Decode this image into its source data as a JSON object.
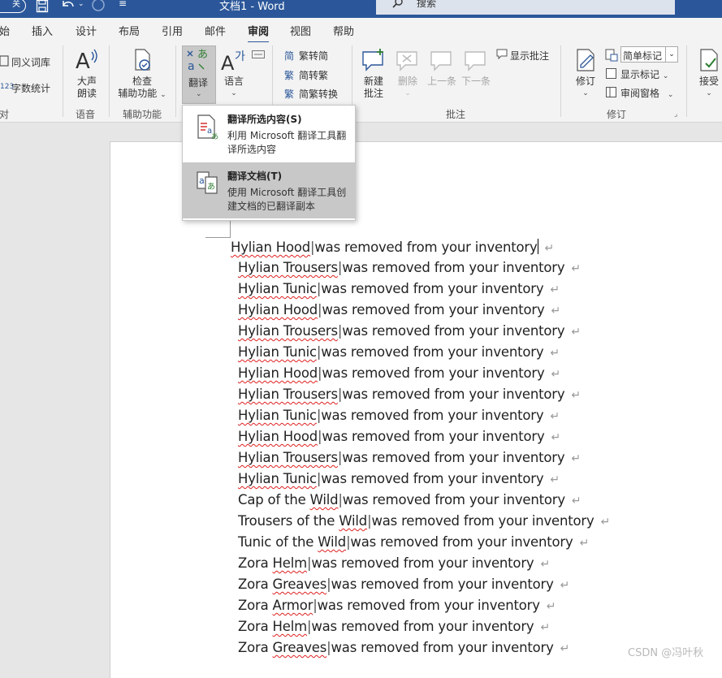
{
  "titlebar": {
    "toggle_label": "关",
    "doc_title": "文档1  -  Word",
    "search_placeholder": "搜索"
  },
  "tabs": [
    {
      "label": "开始",
      "shown": "始"
    },
    {
      "label": "插入"
    },
    {
      "label": "设计"
    },
    {
      "label": "布局"
    },
    {
      "label": "引用"
    },
    {
      "label": "邮件"
    },
    {
      "label": "审阅",
      "active": true
    },
    {
      "label": "视图"
    },
    {
      "label": "帮助"
    }
  ],
  "ribbon": {
    "thesaurus": "同义词库",
    "word_count": "字数统计",
    "proofing_label": "对",
    "read_aloud": [
      "大声",
      "朗读"
    ],
    "speech_label": "语音",
    "check_access": [
      "检查",
      "辅助功能"
    ],
    "accessibility_label": "辅助功能",
    "translate": "翻译",
    "language": "语言",
    "trad_to_simp": "繁转简",
    "simp_to_trad": "简转繁",
    "simp_trad_convert": "简繁转换",
    "new_comment": [
      "新建",
      "批注"
    ],
    "delete": "删除",
    "previous": "上一条",
    "next": "下一条",
    "show_comments": "显示批注",
    "comments_label": "批注",
    "track_changes": "修订",
    "markup_mode": "简单标记",
    "show_markup": "显示标记",
    "review_pane": "审阅窗格",
    "tracking_label": "修订",
    "accept": "接受"
  },
  "dropdown": {
    "items": [
      {
        "title": "翻译所选内容(S)",
        "desc": "利用 Microsoft 翻译工具翻译所选内容"
      },
      {
        "title": "翻译文档(T)",
        "desc": "使用 Microsoft 翻译工具创建文档的已翻译副本"
      }
    ]
  },
  "document": {
    "suffix": "was removed from your inventory",
    "lines": [
      {
        "name_plain": "",
        "name_sq": "Hylian Hood",
        "first": true
      },
      {
        "name_plain": "",
        "name_sq": "Hylian Trousers"
      },
      {
        "name_plain": "",
        "name_sq": "Hylian Tunic"
      },
      {
        "name_plain": "",
        "name_sq": "Hylian Hood"
      },
      {
        "name_plain": "",
        "name_sq": "Hylian Trousers"
      },
      {
        "name_plain": "",
        "name_sq": "Hylian Tunic"
      },
      {
        "name_plain": "",
        "name_sq": "Hylian Hood"
      },
      {
        "name_plain": "",
        "name_sq": "Hylian Trousers"
      },
      {
        "name_plain": "",
        "name_sq": "Hylian Tunic"
      },
      {
        "name_plain": "",
        "name_sq": "Hylian Hood"
      },
      {
        "name_plain": "",
        "name_sq": "Hylian Trousers"
      },
      {
        "name_plain": "",
        "name_sq": "Hylian Tunic"
      },
      {
        "name_plain": "Cap of the ",
        "name_sq": "Wild"
      },
      {
        "name_plain": "Trousers of the ",
        "name_sq": "Wild"
      },
      {
        "name_plain": "Tunic of the ",
        "name_sq": "Wild"
      },
      {
        "name_plain": "Zora ",
        "name_sq": "Helm"
      },
      {
        "name_plain": "Zora ",
        "name_sq": "Greaves"
      },
      {
        "name_plain": "Zora ",
        "name_sq": "Armor"
      },
      {
        "name_plain": "Zora ",
        "name_sq": "Helm"
      },
      {
        "name_plain": "Zora ",
        "name_sq": "Greaves"
      }
    ]
  },
  "watermark": "CSDN @冯叶秋",
  "colors": {
    "accent": "#2b579a",
    "squiggle": "#e02020"
  }
}
